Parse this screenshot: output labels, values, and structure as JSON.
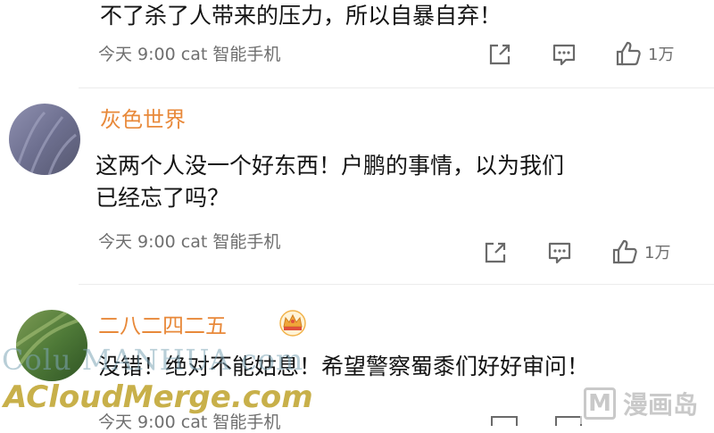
{
  "comments": [
    {
      "text_lines": [
        "不了杀了人带来的压力，所以自暴自弃！"
      ],
      "meta": "今天 9:00 cat 智能手机",
      "like_count": "1万"
    },
    {
      "username": "灰色世界",
      "text_lines": [
        "这两个人没一个好东西！户鹏的事情，以为我们",
        "已经忘了吗？"
      ],
      "meta": "今天 9:00 cat 智能手机",
      "like_count": "1万"
    },
    {
      "username": "二八二四二五",
      "text_lines": [
        "没错！绝对不能姑息！希望警察蜀黍们好好审问！"
      ],
      "meta": "今天 9:00 cat 智能手机"
    }
  ],
  "icons": {
    "share": "share-icon",
    "comment": "comment-icon",
    "like": "thumbs-up-icon",
    "badge": "crown-badge-icon"
  },
  "watermarks": {
    "left_top": "Colu MANHUA com",
    "left_bottom": "ACloudMerge.com",
    "right_logo_letter": "M",
    "right_logo_text": "漫画岛"
  },
  "colors": {
    "username": "#e8893a",
    "meta": "#6f6f6f",
    "watermark_green": "#c8b04a",
    "watermark_logo": "#c9c9c9"
  }
}
